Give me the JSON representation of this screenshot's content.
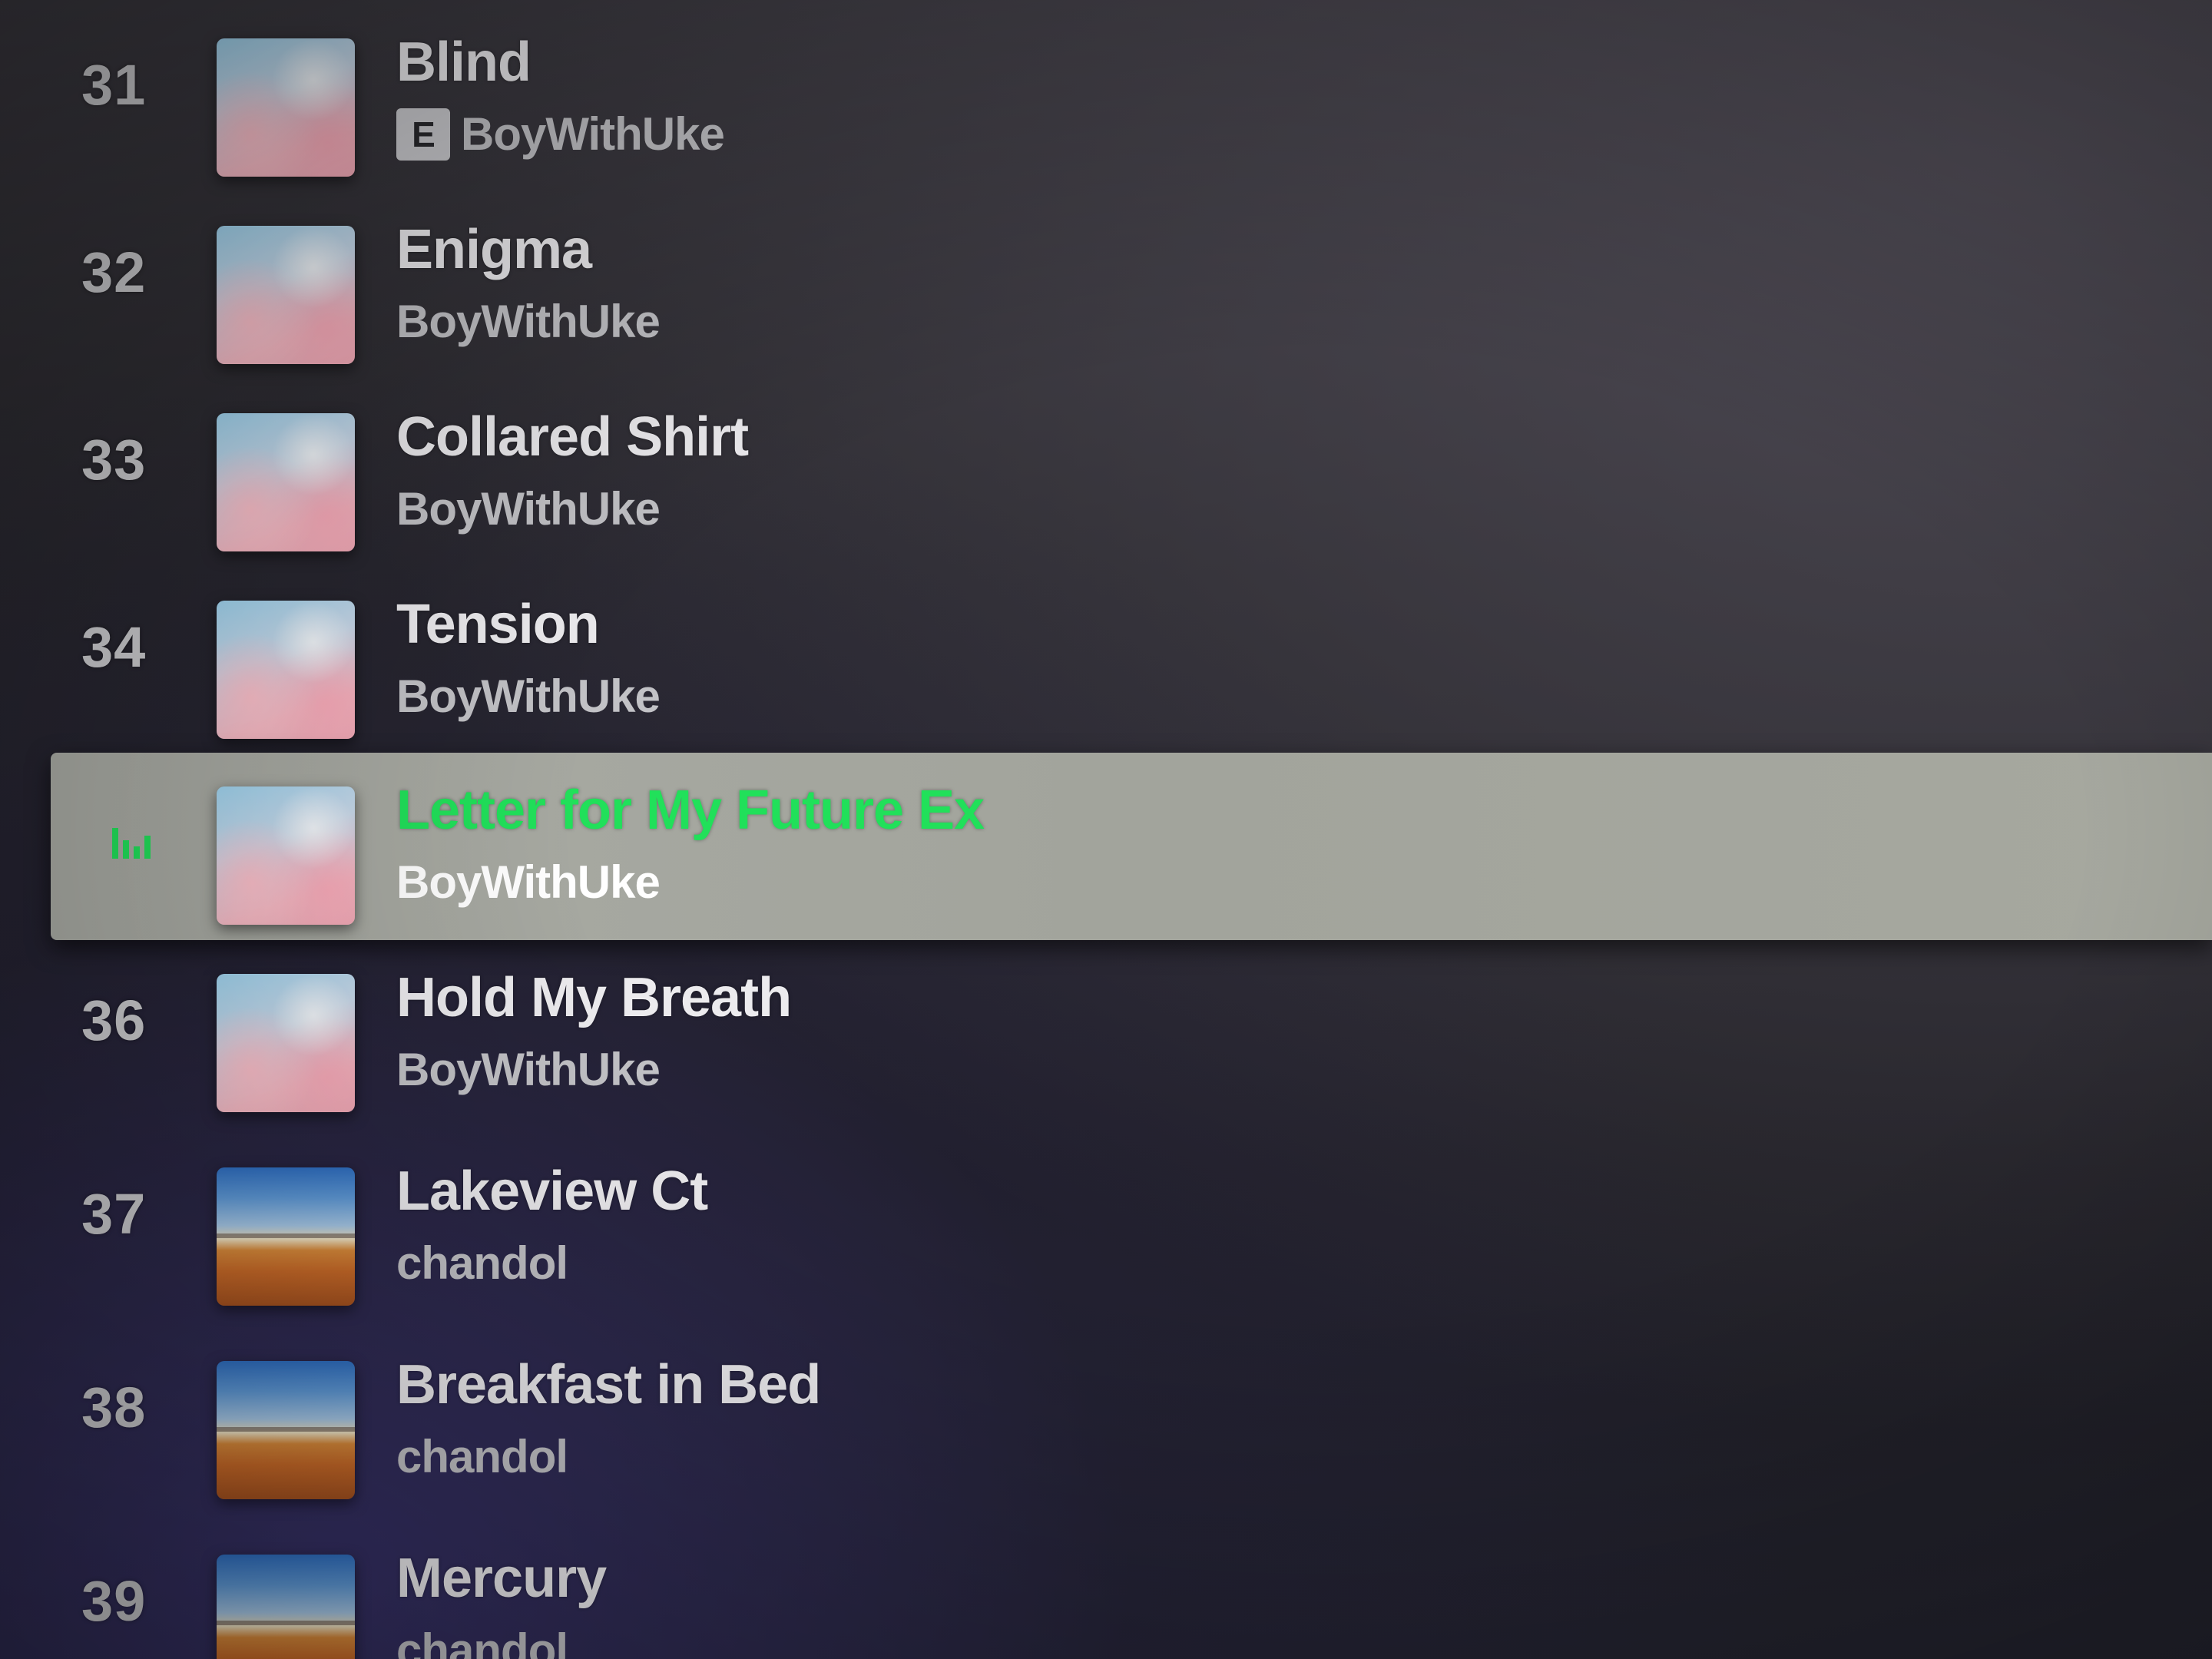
{
  "tracks": [
    {
      "number": "31",
      "title": "Blind",
      "artist": "BoyWithUke",
      "explicit": "E",
      "art": "pink-clouds-cover"
    },
    {
      "number": "32",
      "title": "Enigma",
      "artist": "BoyWithUke",
      "art": "pink-clouds-cover"
    },
    {
      "number": "33",
      "title": "Collared Shirt",
      "artist": "BoyWithUke",
      "art": "pink-clouds-cover"
    },
    {
      "number": "34",
      "title": "Tension",
      "artist": "BoyWithUke",
      "art": "pink-clouds-cover"
    },
    {
      "title": "Letter for My Future Ex",
      "artist": "BoyWithUke",
      "playing_icon": "equalizer-icon",
      "art": "pink-clouds-cover"
    },
    {
      "number": "36",
      "title": "Hold My Breath",
      "artist": "BoyWithUke",
      "art": "pink-clouds-cover"
    },
    {
      "number": "37",
      "title": "Lakeview Ct",
      "artist": "chandol",
      "art": "sky-field-cover"
    },
    {
      "number": "38",
      "title": "Breakfast in Bed",
      "artist": "chandol",
      "art": "sky-field-cover"
    },
    {
      "number": "39",
      "title": "Mercury",
      "artist": "chandol",
      "art": "sky-field-cover"
    }
  ],
  "colors": {
    "playing_accent": "#21e05a",
    "active_row_bg": "#a6a89f",
    "text_primary": "#ecebee",
    "text_secondary": "#c2c2c6"
  }
}
